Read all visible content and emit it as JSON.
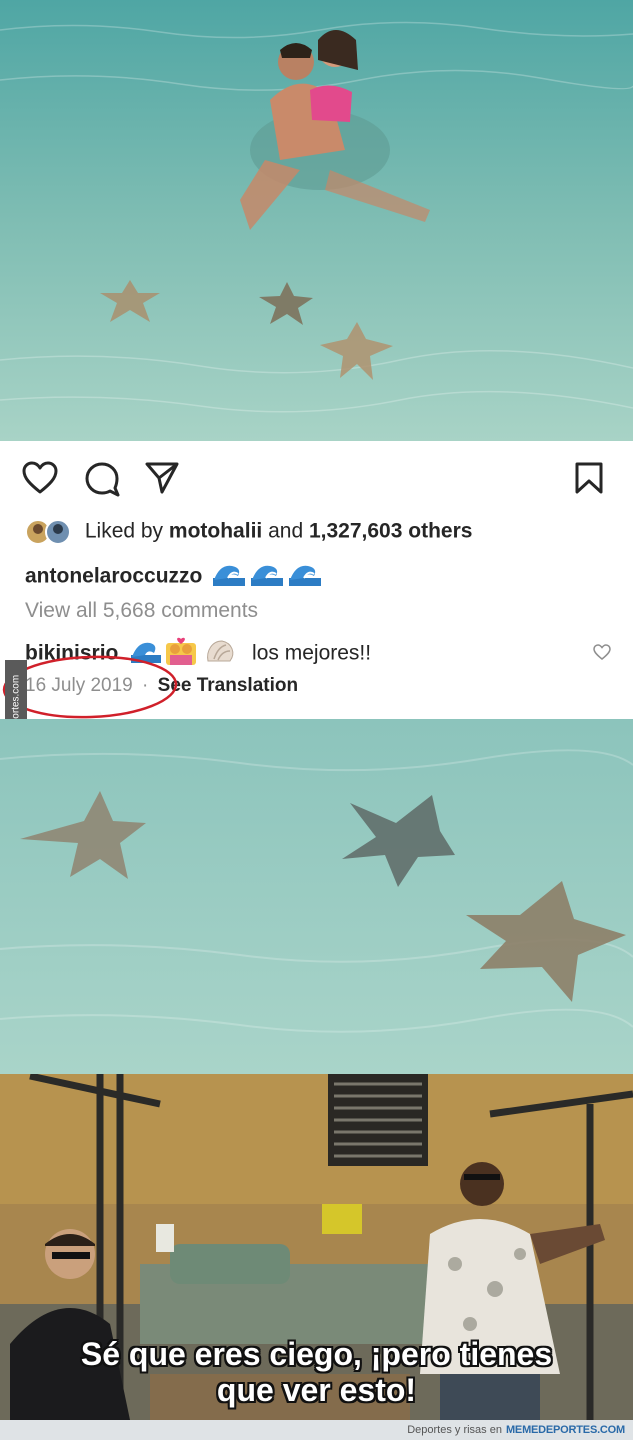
{
  "post": {
    "liked_prefix": "Liked by",
    "liked_user": "motohalii",
    "liked_and": "and",
    "liked_count": "1,327,603 others",
    "author": "antonelaroccuzzo",
    "view_comments": "View all 5,668 comments",
    "comment_user": "bikinisrio",
    "comment_text": "los mejores!!",
    "date": "16 July 2019",
    "separator": "·",
    "see_translation": "See Translation"
  },
  "icons": {
    "like": "heart-icon",
    "comment": "comment-icon",
    "share": "share-icon",
    "save": "bookmark-icon",
    "comment_like": "small-heart-icon",
    "wave_emoji": "wave-emoji",
    "couple_emoji": "couple-emoji",
    "shell_emoji": "shell-emoji"
  },
  "watermark": {
    "side": "Memedeportes.com",
    "footer_prefix": "Deportes y risas en",
    "footer_site": "MEMEDEPORTES.COM"
  },
  "meme": {
    "caption_line1": "Sé que eres ciego, ¡pero tienes",
    "caption_line2": "que ver esto!"
  },
  "colors": {
    "water": "#8fc6bd",
    "annotation_red": "#d0202a",
    "text": "#262626",
    "muted": "#8e8e8e"
  }
}
